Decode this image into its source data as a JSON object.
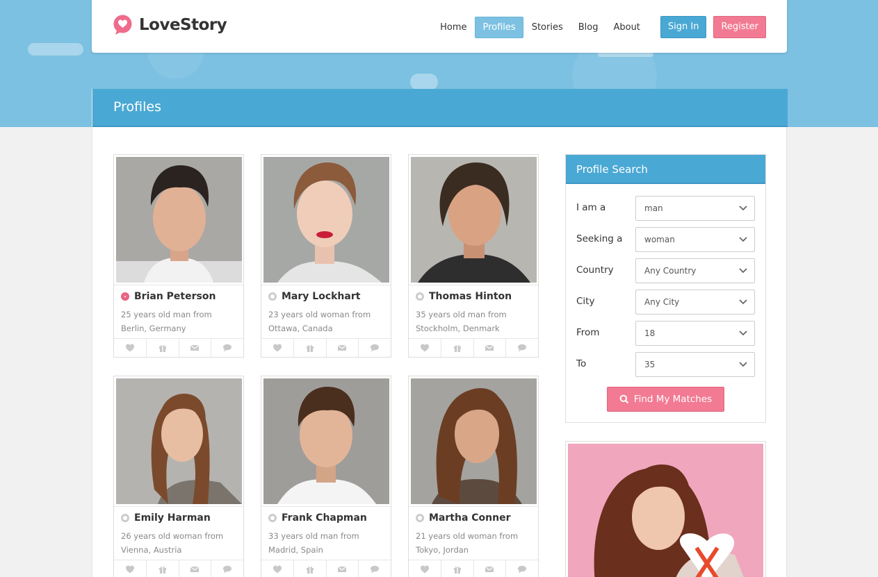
{
  "brand": {
    "name": "LoveStory",
    "accent": "#4aa8d4",
    "pink": "#f27a93"
  },
  "nav": {
    "items": [
      {
        "label": "Home",
        "active": false
      },
      {
        "label": "Profiles",
        "active": true
      },
      {
        "label": "Stories",
        "active": false
      },
      {
        "label": "Blog",
        "active": false
      },
      {
        "label": "About",
        "active": false
      }
    ],
    "signin": "Sign In",
    "register": "Register"
  },
  "page": {
    "title": "Profiles"
  },
  "profiles": [
    {
      "name": "Brian Peterson",
      "desc": "25 years old man from Berlin, Germany",
      "online": true,
      "icon": "person-photo"
    },
    {
      "name": "Mary Lockhart",
      "desc": "23 years old woman from Ottawa, Canada",
      "online": false,
      "icon": "person-photo"
    },
    {
      "name": "Thomas Hinton",
      "desc": "35 years old man from Stockholm, Denmark",
      "online": false,
      "icon": "person-photo"
    },
    {
      "name": "Emily Harman",
      "desc": "26 years old woman from Vienna, Austria",
      "online": false,
      "icon": "person-photo"
    },
    {
      "name": "Frank Chapman",
      "desc": "33 years old man from Madrid, Spain",
      "online": false,
      "icon": "person-photo"
    },
    {
      "name": "Martha Conner",
      "desc": "21 years old woman from Tokyo, Jordan",
      "online": false,
      "icon": "person-photo"
    }
  ],
  "card_actions": [
    "heart-icon",
    "gift-icon",
    "mail-icon",
    "chat-icon"
  ],
  "search": {
    "title": "Profile Search",
    "fields": [
      {
        "label": "I am a",
        "value": "man"
      },
      {
        "label": "Seeking a",
        "value": "woman"
      },
      {
        "label": "Country",
        "value": "Any Country"
      },
      {
        "label": "City",
        "value": "Any City"
      },
      {
        "label": "From",
        "value": "18"
      },
      {
        "label": "To",
        "value": "35"
      }
    ],
    "button": "Find My Matches"
  }
}
